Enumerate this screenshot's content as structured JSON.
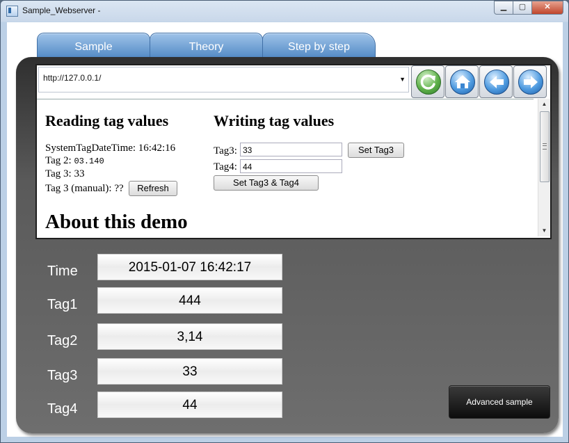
{
  "window": {
    "title": "Sample_Webserver -",
    "min_icon": "minimize-icon",
    "max_icon": "maximize-icon",
    "close_icon": "close-icon",
    "close_glyph": "✕",
    "min_glyph": "▁",
    "max_glyph": "▢"
  },
  "tabs": [
    {
      "label": "Sample"
    },
    {
      "label": "Theory"
    },
    {
      "label": "Step by step"
    }
  ],
  "browser": {
    "url": "http://127.0.0.1/",
    "nav_icons": [
      "refresh-icon",
      "home-icon",
      "back-arrow-icon",
      "forward-arrow-icon"
    ]
  },
  "web": {
    "reading_heading": "Reading tag values",
    "writing_heading": "Writing tag values",
    "system_time_line": "SystemTagDateTime: 16:42:16",
    "tag2_label": "Tag 2: ",
    "tag2_value": "03.140",
    "tag3_line": "Tag 3: 33",
    "tag3_manual_line": "Tag 3 (manual): ??",
    "refresh_button": "Refresh",
    "tag3_input_label": "Tag3:",
    "tag3_input_value": "33",
    "tag4_input_label": "Tag4:",
    "tag4_input_value": "44",
    "set_tag3_button": "Set Tag3",
    "set_tag3_tag4_button": "Set Tag3 & Tag4",
    "about_heading": "About this demo"
  },
  "fields": [
    {
      "label": "Time",
      "value": "2015-01-07 16:42:17"
    },
    {
      "label": "Tag1",
      "value": "444"
    },
    {
      "label": "Tag2",
      "value": "3,14"
    },
    {
      "label": "Tag3",
      "value": "33"
    },
    {
      "label": "Tag4",
      "value": "44"
    }
  ],
  "advanced_button": "Advanced sample",
  "colors": {
    "tab_blue": "#4d86c3",
    "panel_dark": "#2f2f2f",
    "close_red": "#c0462c"
  }
}
